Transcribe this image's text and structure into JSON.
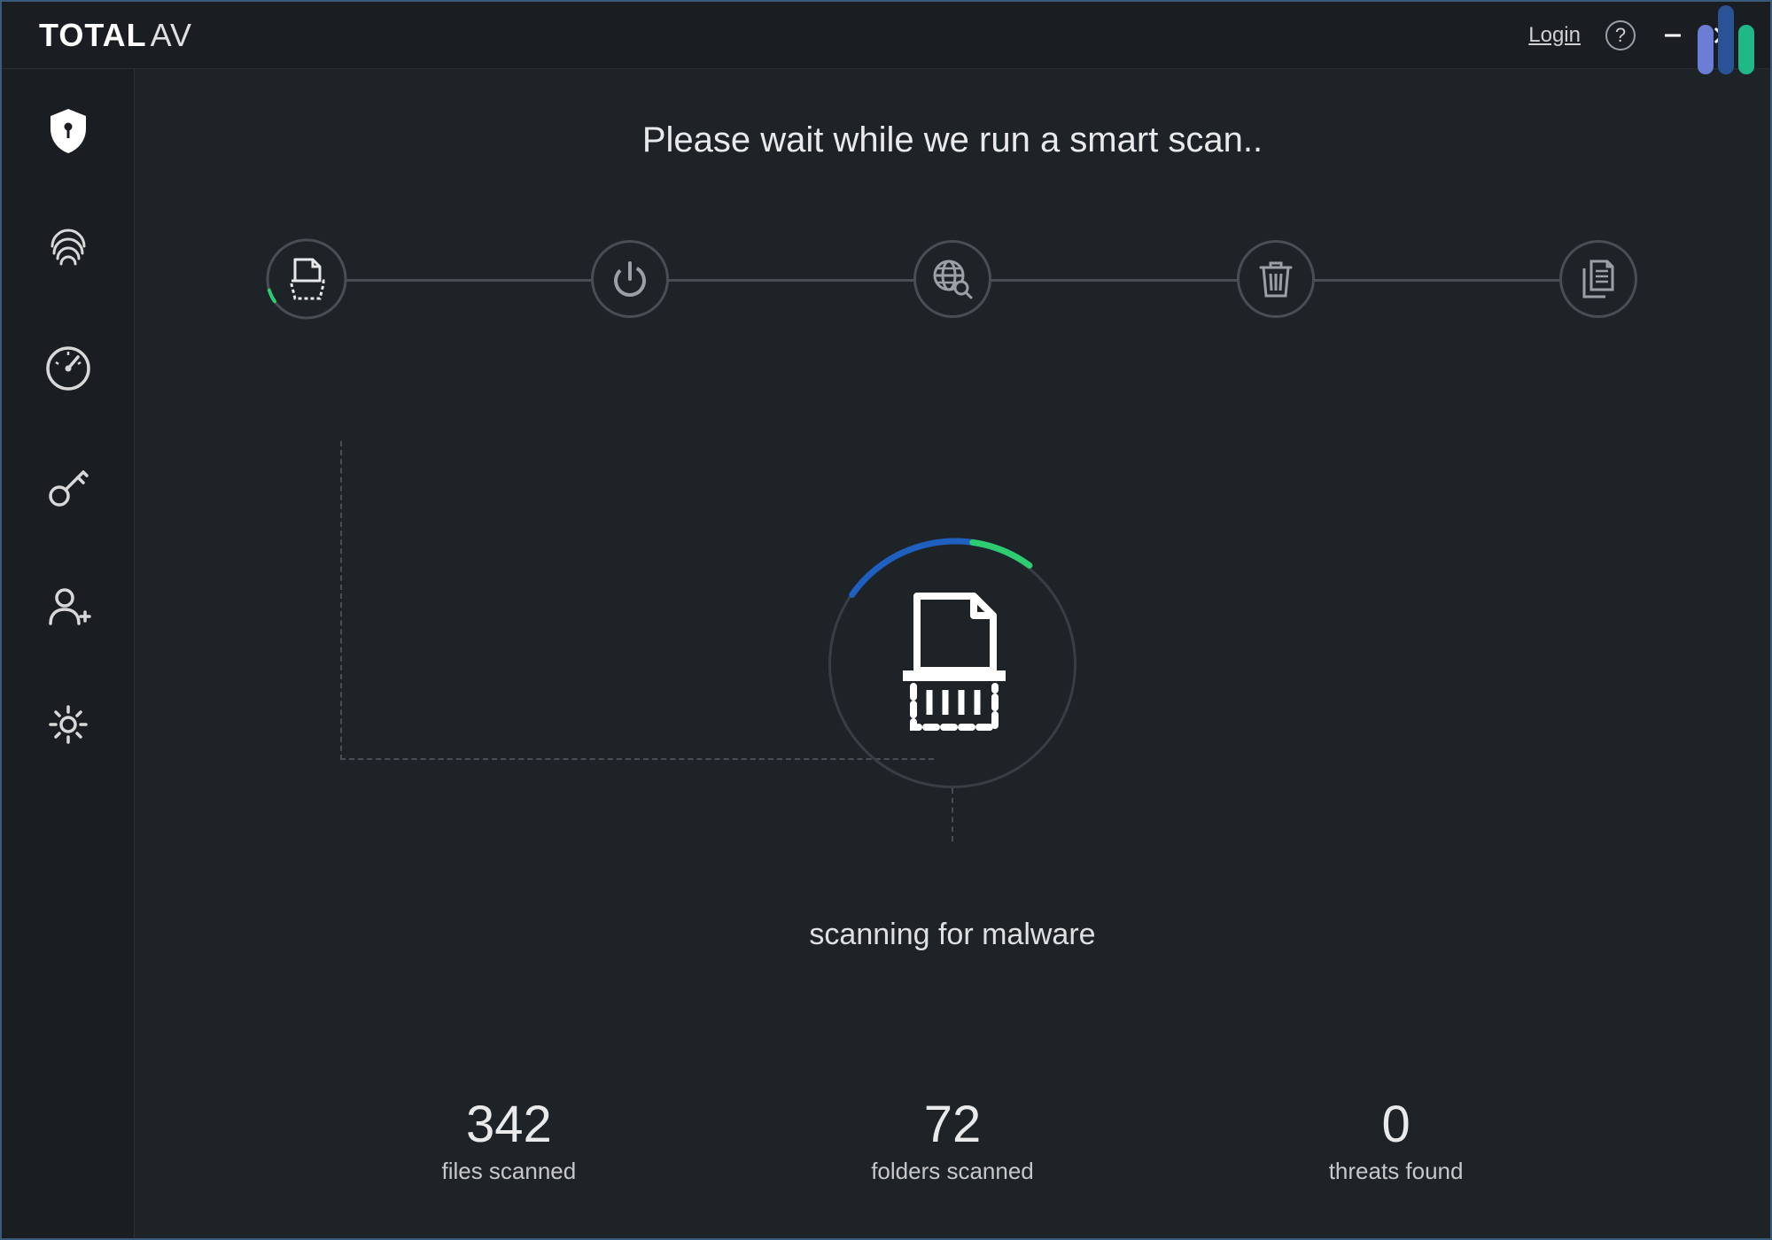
{
  "brand": {
    "bold": "TOTAL",
    "light": "AV"
  },
  "titlebar": {
    "login": "Login"
  },
  "sidebar": {
    "items": [
      "shield",
      "fingerprint",
      "speedometer",
      "key",
      "add-user",
      "settings"
    ]
  },
  "main": {
    "heading": "Please wait while we run a smart scan.."
  },
  "steps": [
    "scan",
    "power",
    "web",
    "trash",
    "duplicate"
  ],
  "scan": {
    "status": "scanning for malware"
  },
  "stats": {
    "files": {
      "value": "342",
      "label": "files scanned"
    },
    "folders": {
      "value": "72",
      "label": "folders scanned"
    },
    "threats": {
      "value": "0",
      "label": "threats found"
    }
  },
  "colors": {
    "accent_green": "#2ecc71",
    "accent_blue": "#1f5fbf"
  }
}
